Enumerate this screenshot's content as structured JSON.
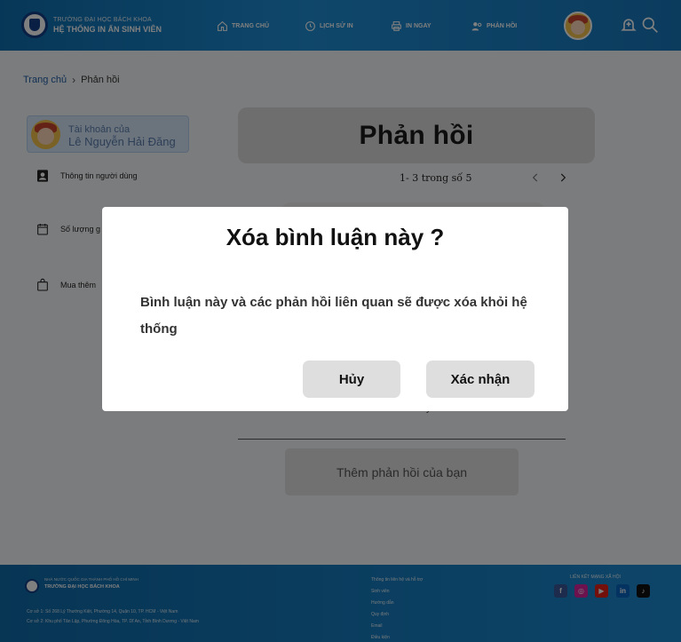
{
  "header": {
    "brand_line1": "TRƯỜNG ĐẠI HỌC BÁCH KHOA",
    "brand_line2": "HỆ THỐNG IN ẤN SINH VIÊN",
    "nav": [
      {
        "label": "TRANG CHỦ",
        "icon": "home-icon"
      },
      {
        "label": "LỊCH SỬ IN",
        "icon": "history-icon"
      },
      {
        "label": "IN NGAY",
        "icon": "printer-icon"
      },
      {
        "label": "PHẢN HỒI",
        "icon": "feedback-icon"
      }
    ],
    "icons": [
      "avatar",
      "notification-bell-icon",
      "search-icon"
    ]
  },
  "breadcrumb": {
    "home": "Trang chủ",
    "current": "Phản hồi"
  },
  "sidebar": {
    "account_caption": "Tài khoản của",
    "account_name": "Lê Nguyễn Hải Đăng",
    "items": [
      {
        "label": "Thông tin người dùng",
        "icon": "user-card-icon"
      },
      {
        "label": "Số lượng g",
        "icon": "calendar-icon"
      },
      {
        "label": "Mua thêm",
        "icon": "shopping-bag-icon"
      }
    ]
  },
  "main": {
    "title": "Phản hồi",
    "pagination": "1- 3 trong số 5",
    "snippet": "y",
    "add_feedback_placeholder": "Thêm phản hồi của bạn"
  },
  "footer": {
    "brand_line1": "NHÀ NƯỚC QUỐC GIA THÀNH PHỐ HỒ CHÍ MINH",
    "brand_line2": "TRƯỜNG ĐẠI HỌC BÁCH KHOA",
    "address1": "Cơ sở 1: Số 268 Lý Thường Kiệt, Phường 14, Quận 10, TP. HCM - Việt Nam",
    "address2": "Cơ sở 2: Khu phố Tân Lập, Phường Đông Hòa, TP. Dĩ An, Tỉnh Bình Dương - Việt Nam",
    "links": [
      "Thông tin liên hệ và hỗ trợ",
      "Sinh viên",
      "Hướng dẫn",
      "Quy định",
      "Email",
      "Điều kiện"
    ],
    "social_title": "LIÊN KẾT MẠNG XÃ HỘI",
    "social": [
      {
        "name": "facebook-icon",
        "color": "#3b5998",
        "glyph": "f"
      },
      {
        "name": "instagram-icon",
        "color": "#d6249f",
        "glyph": "◎"
      },
      {
        "name": "youtube-icon",
        "color": "#e62117",
        "glyph": "▶"
      },
      {
        "name": "linkedin-icon",
        "color": "#0a66c2",
        "glyph": "in"
      },
      {
        "name": "tiktok-icon",
        "color": "#111111",
        "glyph": "♪"
      }
    ]
  },
  "modal": {
    "title": "Xóa bình luận này ?",
    "message": "Bình luận này và các phản hồi liên quan sẽ được xóa khỏi hệ thống",
    "cancel_label": "Hủy",
    "confirm_label": "Xác nhận"
  }
}
